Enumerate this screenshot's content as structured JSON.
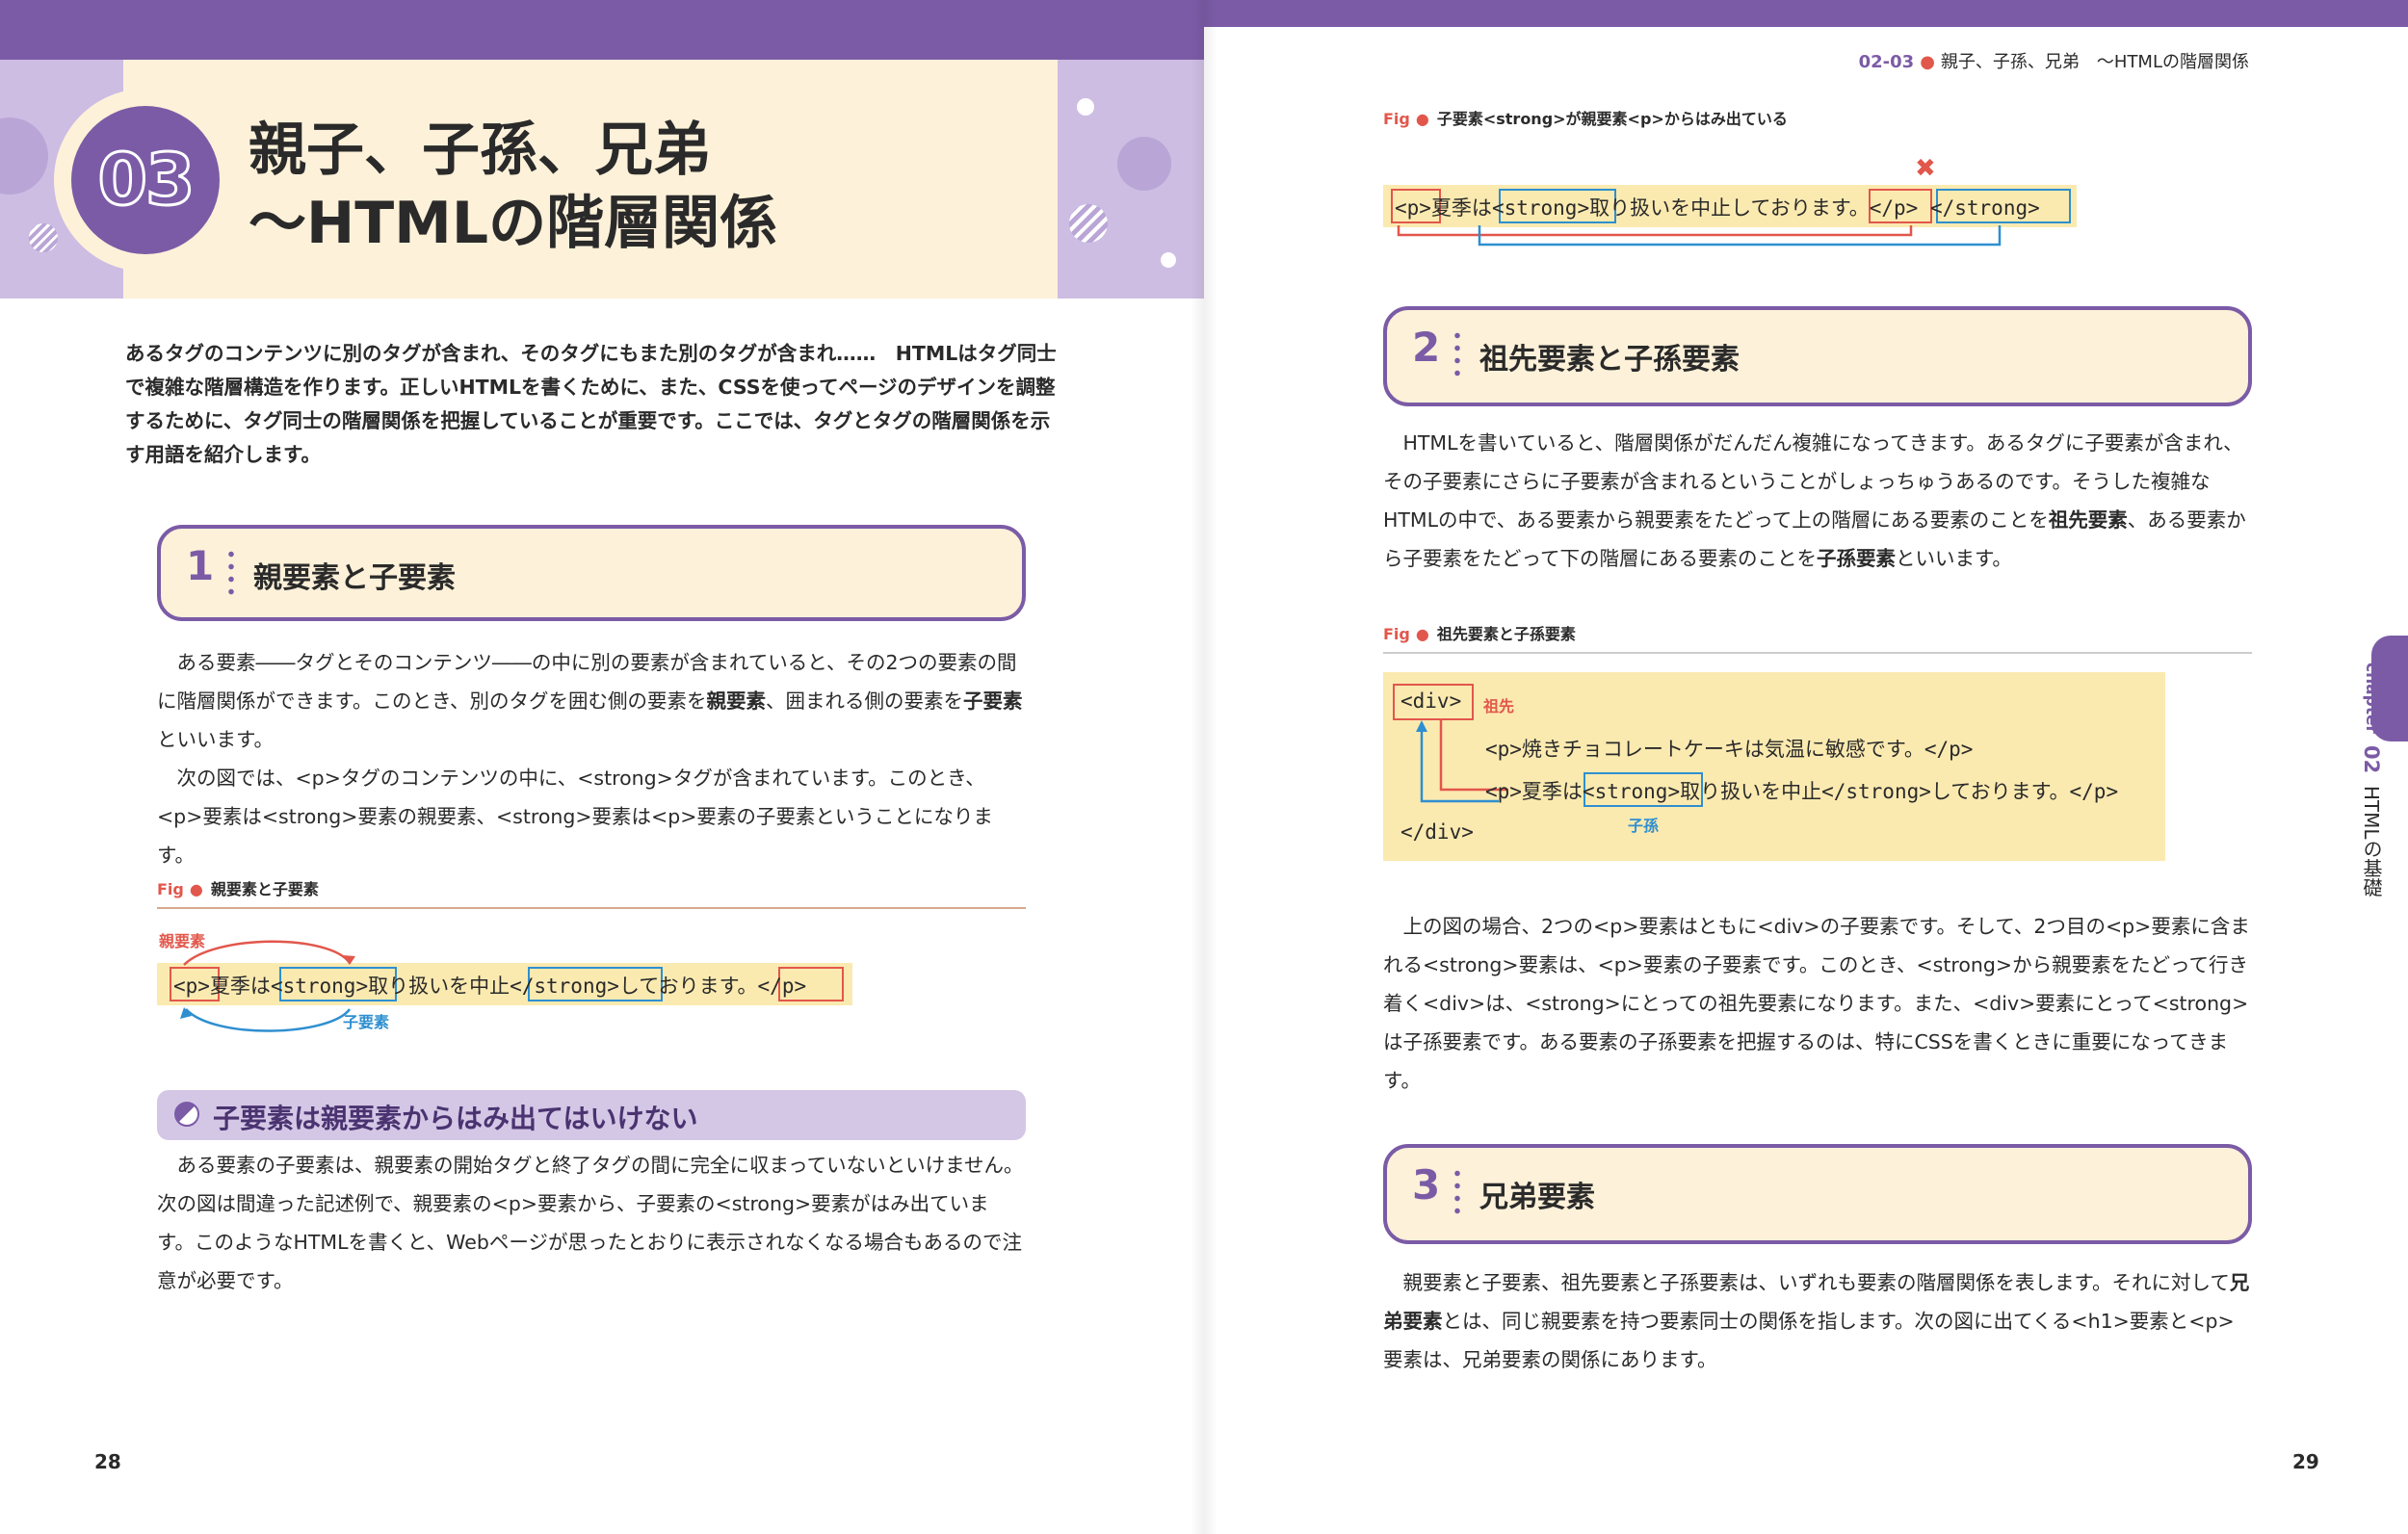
{
  "left": {
    "chapter_number": "03",
    "title_line1": "親子、子孫、兄弟",
    "title_line2": "～HTMLの階層関係",
    "lead": "あるタグのコンテンツに別のタグが含まれ、そのタグにもまた別のタグが含まれ……　HTMLはタグ同士で複雑な階層構造を作ります。正しいHTMLを書くために、また、CSSを使ってページのデザインを調整するために、タグ同士の階層関係を把握していることが重要です。ここでは、タグとタグの階層関係を示す用語を紹介します。",
    "section1": {
      "num": "1",
      "title": "親要素と子要素",
      "p1_a": "　ある要素――タグとそのコンテンツ――の中に別の要素が含まれていると、その2つの要素の間に階層関係ができます。このとき、別のタグを囲む側の要素を",
      "p1_b1": "親要素",
      "p1_c": "、囲まれる側の要素を",
      "p1_b2": "子要素",
      "p1_d": "といいます。",
      "p2": "　次の図では、<p>タグのコンテンツの中に、<strong>タグが含まれています。このとき、<p>要素は<strong>要素の親要素、<strong>要素は<p>要素の子要素ということになります。"
    },
    "fig1": {
      "label": "Fig",
      "dot": "●",
      "caption": "親要素と子要素",
      "parent_label": "親要素",
      "child_label": "子要素",
      "c1": "<p>",
      "c2": "夏季は",
      "c3": "<strong>",
      "c4": "取り扱いを中止",
      "c5": "</strong>",
      "c6": "しております。",
      "c7": "</p>"
    },
    "tip": {
      "title": "子要素は親要素からはみ出てはいけない",
      "text": "　ある要素の子要素は、親要素の開始タグと終了タグの間に完全に収まっていないといけません。次の図は間違った記述例で、親要素の<p>要素から、子要素の<strong>要素がはみ出ています。このようなHTMLを書くと、Webページが思ったとおりに表示されなくなる場合もあるので注意が必要です。"
    },
    "page_number": "28"
  },
  "right": {
    "running_head_code": "02-03",
    "running_head_dot": "●",
    "running_head_text": "親子、子孫、兄弟　～HTMLの階層関係",
    "fig2": {
      "label": "Fig",
      "dot": "●",
      "caption": "子要素<strong>が親要素<p>からはみ出ている",
      "c1": "<p>",
      "c2": "夏季は",
      "c3": "<strong>",
      "c4": "取り扱いを中止しております。",
      "c5": "</p>",
      "c6": "</strong>",
      "mark": "✖"
    },
    "section2": {
      "num": "2",
      "title": "祖先要素と子孫要素",
      "p_a": "　HTMLを書いていると、階層関係がだんだん複雑になってきます。あるタグに子要素が含まれ、その子要素にさらに子要素が含まれるということがしょっちゅうあるのです。そうした複雑なHTMLの中で、ある要素から親要素をたどって上の階層にある要素のことを",
      "p_b1": "祖先要素",
      "p_c": "、ある要素から子要素をたどって下の階層にある要素のことを",
      "p_b2": "子孫要素",
      "p_d": "といいます。"
    },
    "fig3": {
      "label": "Fig",
      "dot": "●",
      "caption": "祖先要素と子孫要素",
      "line1": "<div>",
      "ancestor_label": "祖先",
      "line2": "<p>焼きチョコレートケーキは気温に敏感です。</p>",
      "line3_a": "<p>夏季は",
      "line3_b": "<strong>",
      "line3_c": "取り扱いを中止</strong>しております。</p>",
      "descendant_label": "子孫",
      "line4": "</div>"
    },
    "p_after_fig3": "　上の図の場合、2つの<p>要素はともに<div>の子要素です。そして、2つ目の<p>要素に含まれる<strong>要素は、<p>要素の子要素です。このとき、<strong>から親要素をたどって行き着く<div>は、<strong>にとっての祖先要素になります。また、<div>要素にとって<strong>は子孫要素です。ある要素の子孫要素を把握するのは、特にCSSを書くときに重要になってきます。",
    "section3": {
      "num": "3",
      "title": "兄弟要素",
      "p_a": "　親要素と子要素、祖先要素と子孫要素は、いずれも要素の階層関係を表します。それに対して",
      "p_b": "兄弟要素",
      "p_c": "とは、同じ親要素を持つ要素同士の関係を指します。次の図に出てくる<h1>要素と<p>要素は、兄弟要素の関係にあります。"
    },
    "side_tab": {
      "chapter_word": "chapter",
      "chapter_num": "02",
      "chapter_title": "HTMLの基礎"
    },
    "page_number": "29"
  },
  "colors": {
    "accent": "#7b5ba6",
    "cream": "#fdf1d9",
    "highlight": "#fbeab0",
    "red": "#e2574c",
    "blue": "#2e8fd0"
  }
}
